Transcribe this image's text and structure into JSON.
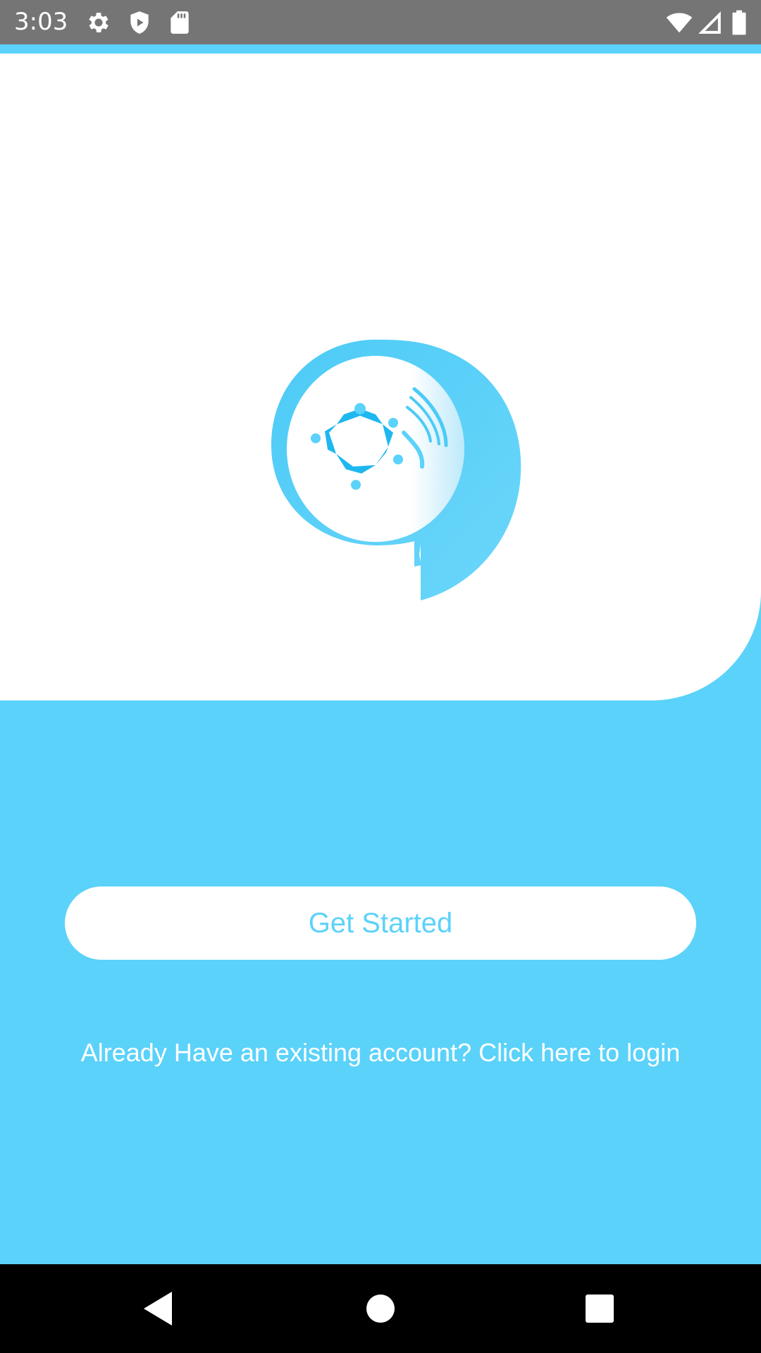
{
  "status_bar": {
    "time": "3:03",
    "left_icons": [
      "settings-icon",
      "shield-icon",
      "sd-card-icon"
    ],
    "right_icons": [
      "wifi-icon",
      "cellular-signal-icon",
      "battery-icon"
    ]
  },
  "colors": {
    "accent": "#5BD2FA",
    "status_bar": "#757575",
    "card": "#FFFFFF",
    "nav_bar": "#000000"
  },
  "hero": {
    "logo_icon": "mind-head-logo-icon"
  },
  "actions": {
    "get_started_label": "Get Started",
    "login_link_text": "Already Have an existing account? Click here to login"
  },
  "nav_bar": {
    "buttons": [
      "back-icon",
      "home-icon",
      "recents-icon"
    ]
  }
}
